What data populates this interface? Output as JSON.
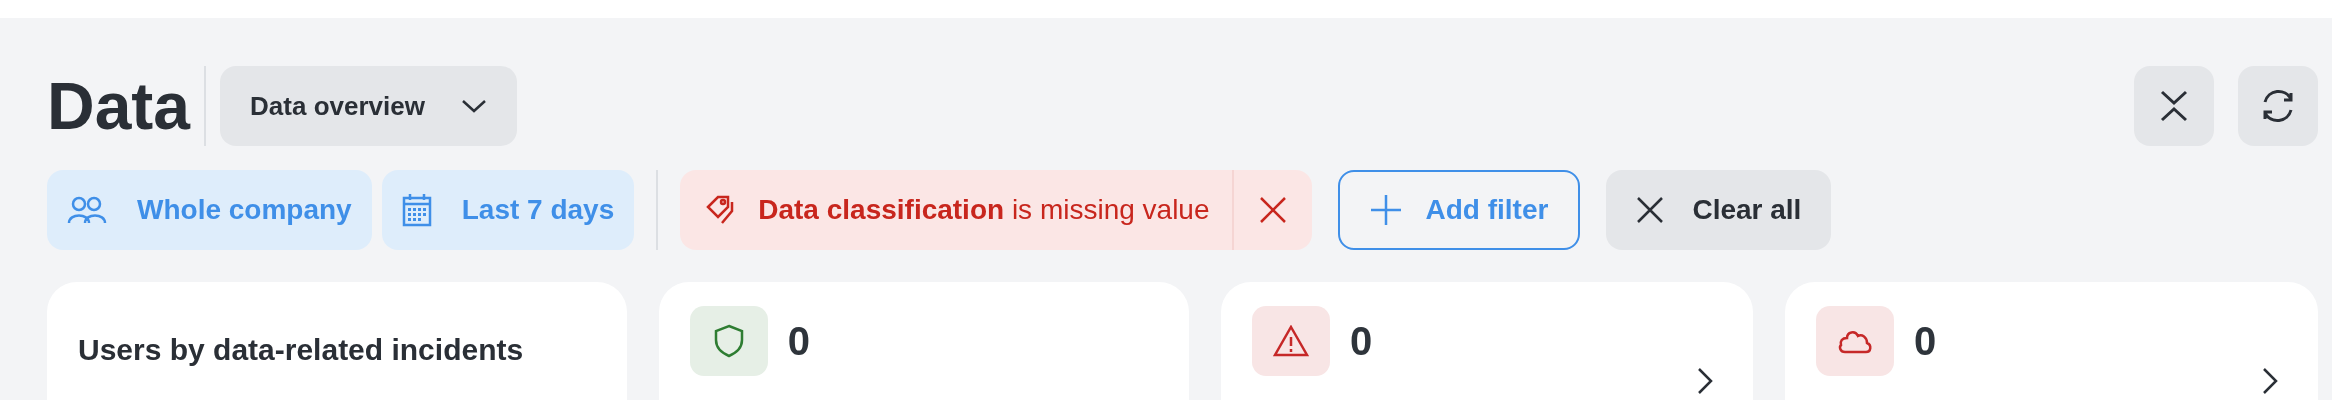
{
  "page": {
    "title": "Data"
  },
  "view_selector": {
    "label": "Data overview"
  },
  "scope_filters": [
    {
      "kind": "people",
      "label": "Whole company"
    },
    {
      "kind": "calendar",
      "label": "Last 7 days"
    }
  ],
  "active_filters": [
    {
      "label": "**Data classification** is missing value"
    }
  ],
  "add_filter": {
    "label": "Add filter"
  },
  "clear_all": {
    "label": "Clear all"
  },
  "cards": [
    {
      "kind": "title",
      "title": "Users by data-related incidents"
    },
    {
      "kind": "shield",
      "value": "0",
      "color": "#2e7d32",
      "link": false
    },
    {
      "kind": "warning",
      "value": "0",
      "color": "#c62828",
      "link": true
    },
    {
      "kind": "cloud",
      "value": "0",
      "color": "#c62828",
      "link": true
    }
  ]
}
